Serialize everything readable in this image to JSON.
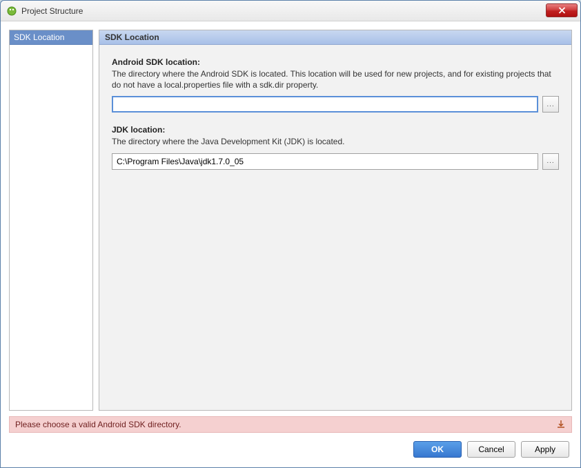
{
  "window": {
    "title": "Project Structure"
  },
  "sidebar": {
    "items": [
      {
        "label": "SDK Location",
        "selected": true
      }
    ]
  },
  "panel": {
    "header": "SDK Location",
    "sdk": {
      "label": "Android SDK location:",
      "desc": "The directory where the Android SDK is located. This location will be used for new projects, and for existing projects that do not have a local.properties file with a sdk.dir property.",
      "value": "",
      "browse": "..."
    },
    "jdk": {
      "label": "JDK location:",
      "desc": "The directory where the Java Development Kit (JDK) is located.",
      "value": "C:\\Program Files\\Java\\jdk1.7.0_05",
      "browse": "..."
    }
  },
  "error": {
    "message": "Please choose a valid Android SDK directory."
  },
  "buttons": {
    "ok": "OK",
    "cancel": "Cancel",
    "apply": "Apply"
  }
}
